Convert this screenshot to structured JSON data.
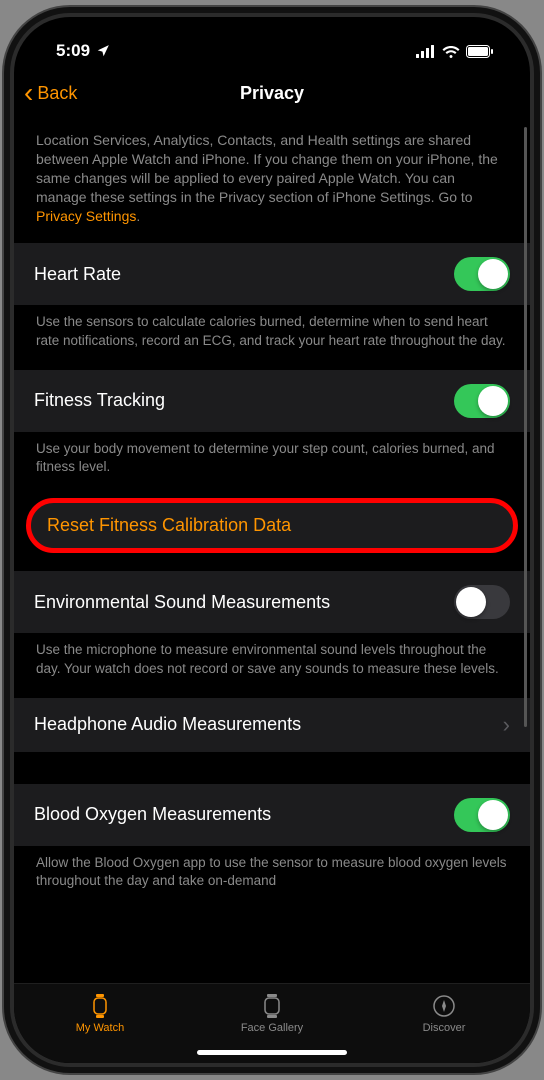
{
  "status": {
    "time": "5:09",
    "location_icon": "location-arrow"
  },
  "nav": {
    "back_label": "Back",
    "title": "Privacy"
  },
  "intro": {
    "text": "Location Services, Analytics, Contacts, and Health settings are shared between Apple Watch and iPhone. If you change them on your iPhone, the same changes will be applied to every paired Apple Watch. You can manage these settings in the Privacy section of iPhone Settings. Go to ",
    "link": "Privacy Settings"
  },
  "settings": [
    {
      "label": "Heart Rate",
      "toggle": "on",
      "footer": "Use the sensors to calculate calories burned, determine when to send heart rate notifications, record an ECG, and track your heart rate throughout the day."
    },
    {
      "label": "Fitness Tracking",
      "toggle": "on",
      "footer": "Use your body movement to determine your step count, calories burned, and fitness level."
    },
    {
      "label": "Reset Fitness Calibration Data",
      "type": "button",
      "highlighted": true
    },
    {
      "label": "Environmental Sound Measurements",
      "toggle": "off",
      "footer": "Use the microphone to measure environmental sound levels throughout the day. Your watch does not record or save any sounds to measure these levels."
    },
    {
      "label": "Headphone Audio Measurements",
      "type": "disclosure"
    },
    {
      "label": "Blood Oxygen Measurements",
      "toggle": "on",
      "footer": "Allow the Blood Oxygen app to use the sensor to measure blood oxygen levels throughout the day and take on-demand"
    }
  ],
  "tabs": [
    {
      "label": "My Watch",
      "active": true
    },
    {
      "label": "Face Gallery",
      "active": false
    },
    {
      "label": "Discover",
      "active": false
    }
  ]
}
